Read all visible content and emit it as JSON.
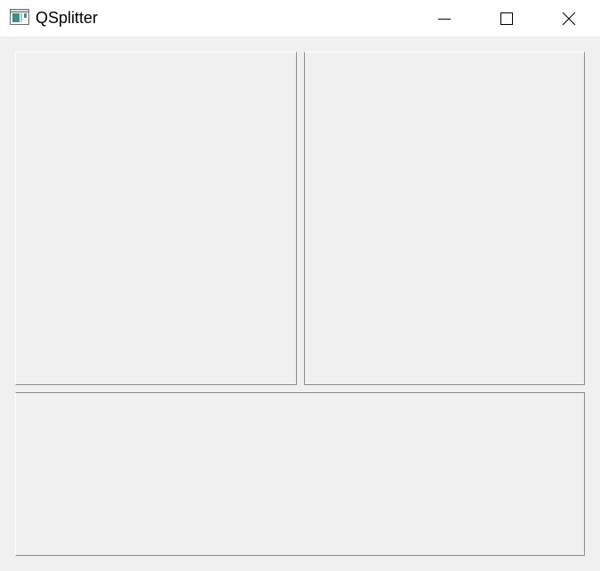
{
  "window": {
    "title": "QSplitter",
    "icon": "qt-app-window-icon",
    "controls": {
      "minimize": "minimize-icon",
      "maximize": "maximize-icon",
      "close": "close-icon"
    }
  },
  "colors": {
    "titlebar": "#ffffff",
    "client_background": "#f0f0f0",
    "frame_shadow": "#8a8a8a",
    "frame_highlight": "#ffffff",
    "icon_teal": "#3f8f86"
  }
}
